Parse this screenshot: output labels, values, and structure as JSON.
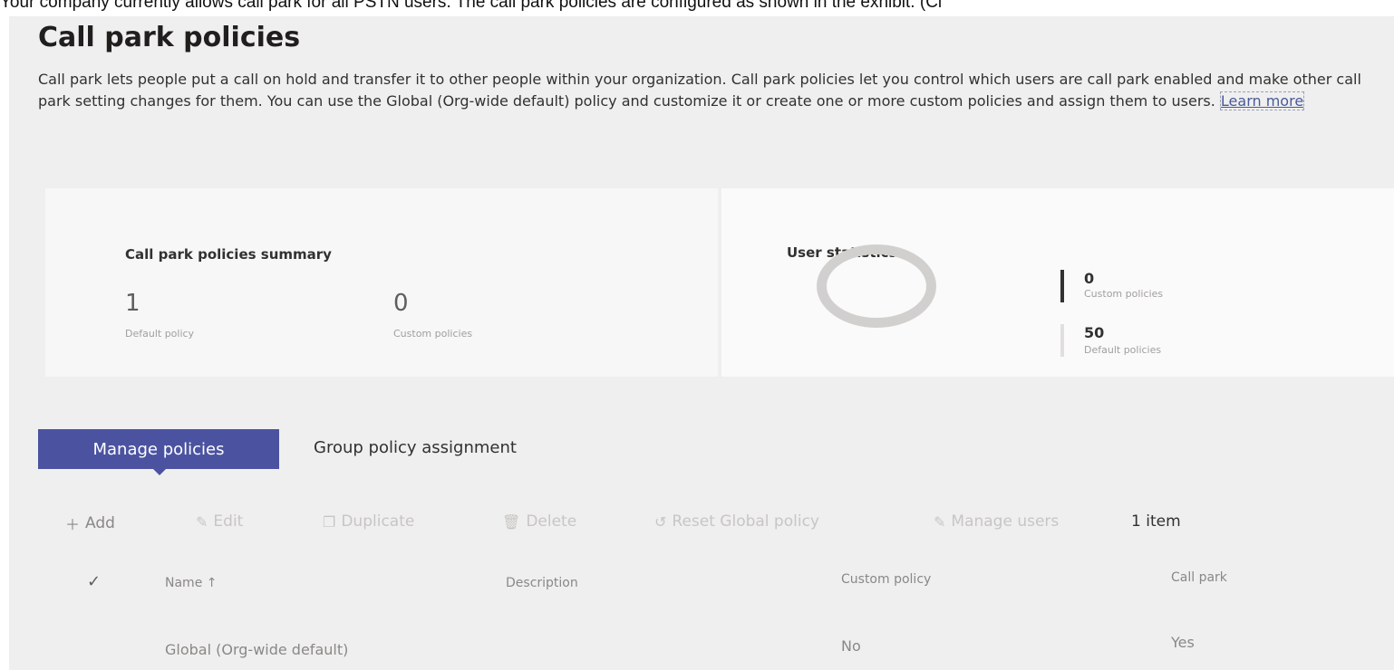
{
  "question_text": "Your company currently allows call park for all PSTN users. The call park policies are configured as shown in the exhibit. (Cl",
  "page": {
    "title": "Call park policies",
    "description": "Call park lets people put a call on hold and transfer it to other people within your organization. Call park policies let you control which users are call park enabled and make other call park setting changes for them. You can use the Global (Org-wide default) policy and customize it or create one or more custom policies and assign them to users.",
    "learn_more": "Learn more"
  },
  "summary": {
    "title": "Call park policies summary",
    "default_count": "1",
    "default_label": "Default policy",
    "custom_count": "0",
    "custom_label": "Custom policies"
  },
  "user_stats": {
    "title": "User statistics",
    "custom_count": "0",
    "custom_label": "Custom policies",
    "default_count": "50",
    "default_label": "Default policies",
    "colors": {
      "custom": "#323130",
      "default": "#e1dfdd",
      "ring": "#d2d0ce"
    }
  },
  "tabs": {
    "manage": "Manage policies",
    "group": "Group policy assignment"
  },
  "toolbar": {
    "add": "Add",
    "edit": "Edit",
    "duplicate": "Duplicate",
    "delete": "Delete",
    "reset": "Reset Global policy",
    "manage_users": "Manage users",
    "item_count": "1 item"
  },
  "table": {
    "columns": [
      "Name ↑",
      "Description",
      "Custom policy",
      "Call park"
    ],
    "rows": [
      {
        "name": "Global (Org-wide default)",
        "description": "",
        "custom_policy": "No",
        "call_park": "Yes"
      }
    ]
  },
  "colors": {
    "accent": "#4b53a1"
  }
}
